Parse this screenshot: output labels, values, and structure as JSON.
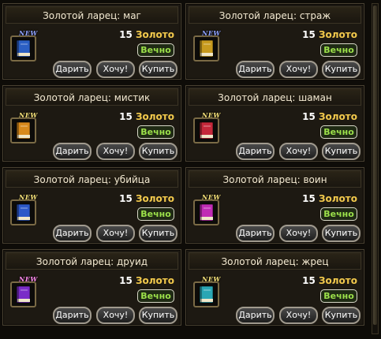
{
  "colors": {
    "new_blue": "#8fa2ff",
    "new_gold": "#f6e27a",
    "new_pink": "#ff8cf0",
    "currency": "#f2c94c",
    "duration": "#9be04a"
  },
  "cards": [
    {
      "title": "Золотой ларец: маг",
      "price": "15",
      "currency": "Золото",
      "duration": "Вечно",
      "badge": "NEW",
      "badge_color": "#8fa2ff",
      "book_color": "#2b5fc4",
      "book_icon": "blue-book-icon",
      "buttons": {
        "gift": "Дарить",
        "want": "Хочу!",
        "buy": "Купить"
      }
    },
    {
      "title": "Золотой ларец: страж",
      "price": "15",
      "currency": "Золото",
      "duration": "Вечно",
      "badge": "NEW",
      "badge_color": "#8fa2ff",
      "book_color": "#c79a1e",
      "book_icon": "gold-book-icon",
      "buttons": {
        "gift": "Дарить",
        "want": "Хочу!",
        "buy": "Купить"
      }
    },
    {
      "title": "Золотой ларец: мистик",
      "price": "15",
      "currency": "Золото",
      "duration": "Вечно",
      "badge": "NEW",
      "badge_color": "#f6e27a",
      "book_color": "#d88a1c",
      "book_icon": "orange-book-icon",
      "buttons": {
        "gift": "Дарить",
        "want": "Хочу!",
        "buy": "Купить"
      }
    },
    {
      "title": "Золотой ларец: шаман",
      "price": "15",
      "currency": "Золото",
      "duration": "Вечно",
      "badge": "NEW",
      "badge_color": "#f6e27a",
      "book_color": "#c4283a",
      "book_icon": "red-book-icon",
      "buttons": {
        "gift": "Дарить",
        "want": "Хочу!",
        "buy": "Купить"
      }
    },
    {
      "title": "Золотой ларец: убийца",
      "price": "15",
      "currency": "Золото",
      "duration": "Вечно",
      "badge": "NEW",
      "badge_color": "#f6e27a",
      "book_color": "#2c58c8",
      "book_icon": "blue-book-icon",
      "buttons": {
        "gift": "Дарить",
        "want": "Хочу!",
        "buy": "Купить"
      }
    },
    {
      "title": "Золотой ларец: воин",
      "price": "15",
      "currency": "Золото",
      "duration": "Вечно",
      "badge": "NEW",
      "badge_color": "#f6e27a",
      "book_color": "#c02cb4",
      "book_icon": "magenta-book-icon",
      "buttons": {
        "gift": "Дарить",
        "want": "Хочу!",
        "buy": "Купить"
      }
    },
    {
      "title": "Золотой ларец: друид",
      "price": "15",
      "currency": "Золото",
      "duration": "Вечно",
      "badge": "NEW",
      "badge_color": "#ff8cf0",
      "book_color": "#7a2cc8",
      "book_icon": "purple-book-icon",
      "buttons": {
        "gift": "Дарить",
        "want": "Хочу!",
        "buy": "Купить"
      }
    },
    {
      "title": "Золотой ларец: жрец",
      "price": "15",
      "currency": "Золото",
      "duration": "Вечно",
      "badge": "NEW",
      "badge_color": "#f6e27a",
      "book_color": "#2aa6b4",
      "book_icon": "teal-book-icon",
      "buttons": {
        "gift": "Дарить",
        "want": "Хочу!",
        "buy": "Купить"
      }
    }
  ]
}
